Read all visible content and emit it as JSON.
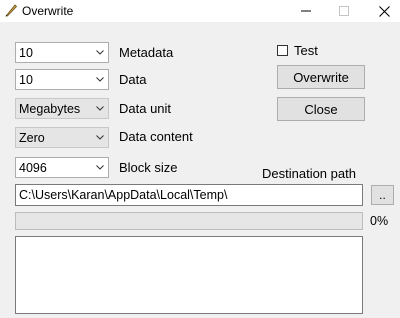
{
  "window": {
    "title": "Overwrite",
    "icon": "feather-pen-icon",
    "controls": {
      "minimize": "—",
      "maximize": "☐",
      "close": "✕"
    }
  },
  "options": [
    {
      "key": "metadata",
      "value": "10",
      "label": "Metadata",
      "style": "white"
    },
    {
      "key": "data",
      "value": "10",
      "label": "Data",
      "style": "white"
    },
    {
      "key": "data_unit",
      "value": "Megabytes",
      "label": "Data unit",
      "style": "grey"
    },
    {
      "key": "data_content",
      "value": "Zero",
      "label": "Data content",
      "style": "grey"
    },
    {
      "key": "block_size",
      "value": "4096",
      "label": "Block size",
      "style": "white"
    }
  ],
  "test_checkbox": {
    "label": "Test",
    "checked": false
  },
  "buttons": {
    "overwrite": "Overwrite",
    "close": "Close",
    "browse": ".."
  },
  "destination": {
    "label": "Destination path",
    "value": "C:\\Users\\Karan\\AppData\\Local\\Temp\\"
  },
  "progress": {
    "fraction": 0,
    "text": "0%"
  },
  "log": {
    "value": ""
  },
  "colors": {
    "window_bg": "#f0f0f0",
    "button_bg": "#e1e1e1",
    "progress_fill": "#06b025"
  }
}
